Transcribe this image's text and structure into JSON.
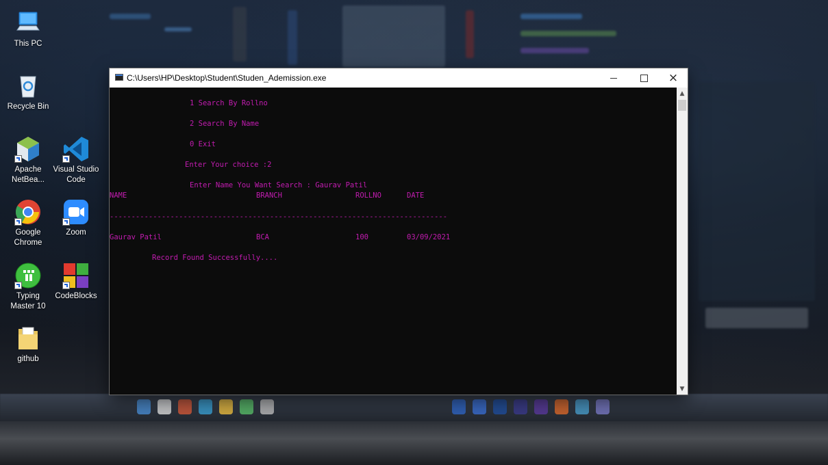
{
  "desktop": {
    "icons": [
      {
        "label": "This PC",
        "icon": "this-pc-icon"
      },
      {
        "label": "Recycle Bin",
        "icon": "recycle-bin-icon"
      },
      {
        "label": "Apache NetBea...",
        "icon": "netbeans-icon"
      },
      {
        "label": "Visual Studio Code",
        "icon": "vscode-icon"
      },
      {
        "label": "Google Chrome",
        "icon": "chrome-icon"
      },
      {
        "label": "Zoom",
        "icon": "zoom-icon"
      },
      {
        "label": "Typing Master 10",
        "icon": "typing-master-icon"
      },
      {
        "label": "CodeBlocks",
        "icon": "codeblocks-icon"
      },
      {
        "label": "github",
        "icon": "folder-icon"
      }
    ]
  },
  "window": {
    "title": "C:\\Users\\HP\\Desktop\\Student\\Studen_Ademission.exe",
    "controls": {
      "minimize": "minimize-icon",
      "maximize": "maximize-icon",
      "close": "×"
    }
  },
  "console": {
    "menu_1": "1 Search By Rollno",
    "menu_2": "2 Search By Name",
    "menu_0": "0 Exit",
    "choice_prompt": "Enter Your choice :2",
    "name_prompt": "Enter Name You Want Search : Gaurav Patil",
    "headers": [
      "NAME",
      "BRANCH",
      "ROLLNO",
      "DATE"
    ],
    "separator": "------------------------------------------------------------------------------",
    "row": [
      "Gaurav Patil",
      "BCA",
      "100",
      "03/09/2021"
    ],
    "status": "Record Found Successfully...."
  },
  "colors": {
    "console_text": "#c21cb0",
    "console_bg": "#0c0c0c",
    "titlebar_bg": "#ffffff"
  }
}
